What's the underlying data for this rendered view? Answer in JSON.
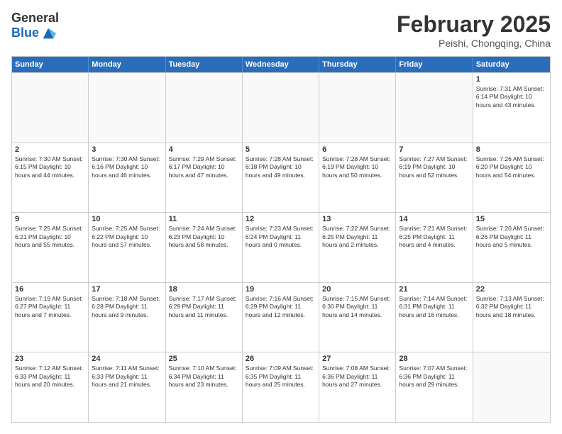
{
  "logo": {
    "general": "General",
    "blue": "Blue"
  },
  "title": {
    "month_year": "February 2025",
    "location": "Peishi, Chongqing, China"
  },
  "header_days": [
    "Sunday",
    "Monday",
    "Tuesday",
    "Wednesday",
    "Thursday",
    "Friday",
    "Saturday"
  ],
  "weeks": [
    [
      {
        "day": "",
        "info": ""
      },
      {
        "day": "",
        "info": ""
      },
      {
        "day": "",
        "info": ""
      },
      {
        "day": "",
        "info": ""
      },
      {
        "day": "",
        "info": ""
      },
      {
        "day": "",
        "info": ""
      },
      {
        "day": "1",
        "info": "Sunrise: 7:31 AM\nSunset: 6:14 PM\nDaylight: 10 hours and 43 minutes."
      }
    ],
    [
      {
        "day": "2",
        "info": "Sunrise: 7:30 AM\nSunset: 6:15 PM\nDaylight: 10 hours and 44 minutes."
      },
      {
        "day": "3",
        "info": "Sunrise: 7:30 AM\nSunset: 6:16 PM\nDaylight: 10 hours and 46 minutes."
      },
      {
        "day": "4",
        "info": "Sunrise: 7:29 AM\nSunset: 6:17 PM\nDaylight: 10 hours and 47 minutes."
      },
      {
        "day": "5",
        "info": "Sunrise: 7:28 AM\nSunset: 6:18 PM\nDaylight: 10 hours and 49 minutes."
      },
      {
        "day": "6",
        "info": "Sunrise: 7:28 AM\nSunset: 6:19 PM\nDaylight: 10 hours and 50 minutes."
      },
      {
        "day": "7",
        "info": "Sunrise: 7:27 AM\nSunset: 6:19 PM\nDaylight: 10 hours and 52 minutes."
      },
      {
        "day": "8",
        "info": "Sunrise: 7:26 AM\nSunset: 6:20 PM\nDaylight: 10 hours and 54 minutes."
      }
    ],
    [
      {
        "day": "9",
        "info": "Sunrise: 7:25 AM\nSunset: 6:21 PM\nDaylight: 10 hours and 55 minutes."
      },
      {
        "day": "10",
        "info": "Sunrise: 7:25 AM\nSunset: 6:22 PM\nDaylight: 10 hours and 57 minutes."
      },
      {
        "day": "11",
        "info": "Sunrise: 7:24 AM\nSunset: 6:23 PM\nDaylight: 10 hours and 58 minutes."
      },
      {
        "day": "12",
        "info": "Sunrise: 7:23 AM\nSunset: 6:24 PM\nDaylight: 11 hours and 0 minutes."
      },
      {
        "day": "13",
        "info": "Sunrise: 7:22 AM\nSunset: 6:25 PM\nDaylight: 11 hours and 2 minutes."
      },
      {
        "day": "14",
        "info": "Sunrise: 7:21 AM\nSunset: 6:25 PM\nDaylight: 11 hours and 4 minutes."
      },
      {
        "day": "15",
        "info": "Sunrise: 7:20 AM\nSunset: 6:26 PM\nDaylight: 11 hours and 5 minutes."
      }
    ],
    [
      {
        "day": "16",
        "info": "Sunrise: 7:19 AM\nSunset: 6:27 PM\nDaylight: 11 hours and 7 minutes."
      },
      {
        "day": "17",
        "info": "Sunrise: 7:18 AM\nSunset: 6:28 PM\nDaylight: 11 hours and 9 minutes."
      },
      {
        "day": "18",
        "info": "Sunrise: 7:17 AM\nSunset: 6:29 PM\nDaylight: 11 hours and 11 minutes."
      },
      {
        "day": "19",
        "info": "Sunrise: 7:16 AM\nSunset: 6:29 PM\nDaylight: 11 hours and 12 minutes."
      },
      {
        "day": "20",
        "info": "Sunrise: 7:15 AM\nSunset: 6:30 PM\nDaylight: 11 hours and 14 minutes."
      },
      {
        "day": "21",
        "info": "Sunrise: 7:14 AM\nSunset: 6:31 PM\nDaylight: 11 hours and 16 minutes."
      },
      {
        "day": "22",
        "info": "Sunrise: 7:13 AM\nSunset: 6:32 PM\nDaylight: 11 hours and 18 minutes."
      }
    ],
    [
      {
        "day": "23",
        "info": "Sunrise: 7:12 AM\nSunset: 6:33 PM\nDaylight: 11 hours and 20 minutes."
      },
      {
        "day": "24",
        "info": "Sunrise: 7:11 AM\nSunset: 6:33 PM\nDaylight: 11 hours and 21 minutes."
      },
      {
        "day": "25",
        "info": "Sunrise: 7:10 AM\nSunset: 6:34 PM\nDaylight: 11 hours and 23 minutes."
      },
      {
        "day": "26",
        "info": "Sunrise: 7:09 AM\nSunset: 6:35 PM\nDaylight: 11 hours and 25 minutes."
      },
      {
        "day": "27",
        "info": "Sunrise: 7:08 AM\nSunset: 6:36 PM\nDaylight: 11 hours and 27 minutes."
      },
      {
        "day": "28",
        "info": "Sunrise: 7:07 AM\nSunset: 6:36 PM\nDaylight: 11 hours and 29 minutes."
      },
      {
        "day": "",
        "info": ""
      }
    ]
  ]
}
